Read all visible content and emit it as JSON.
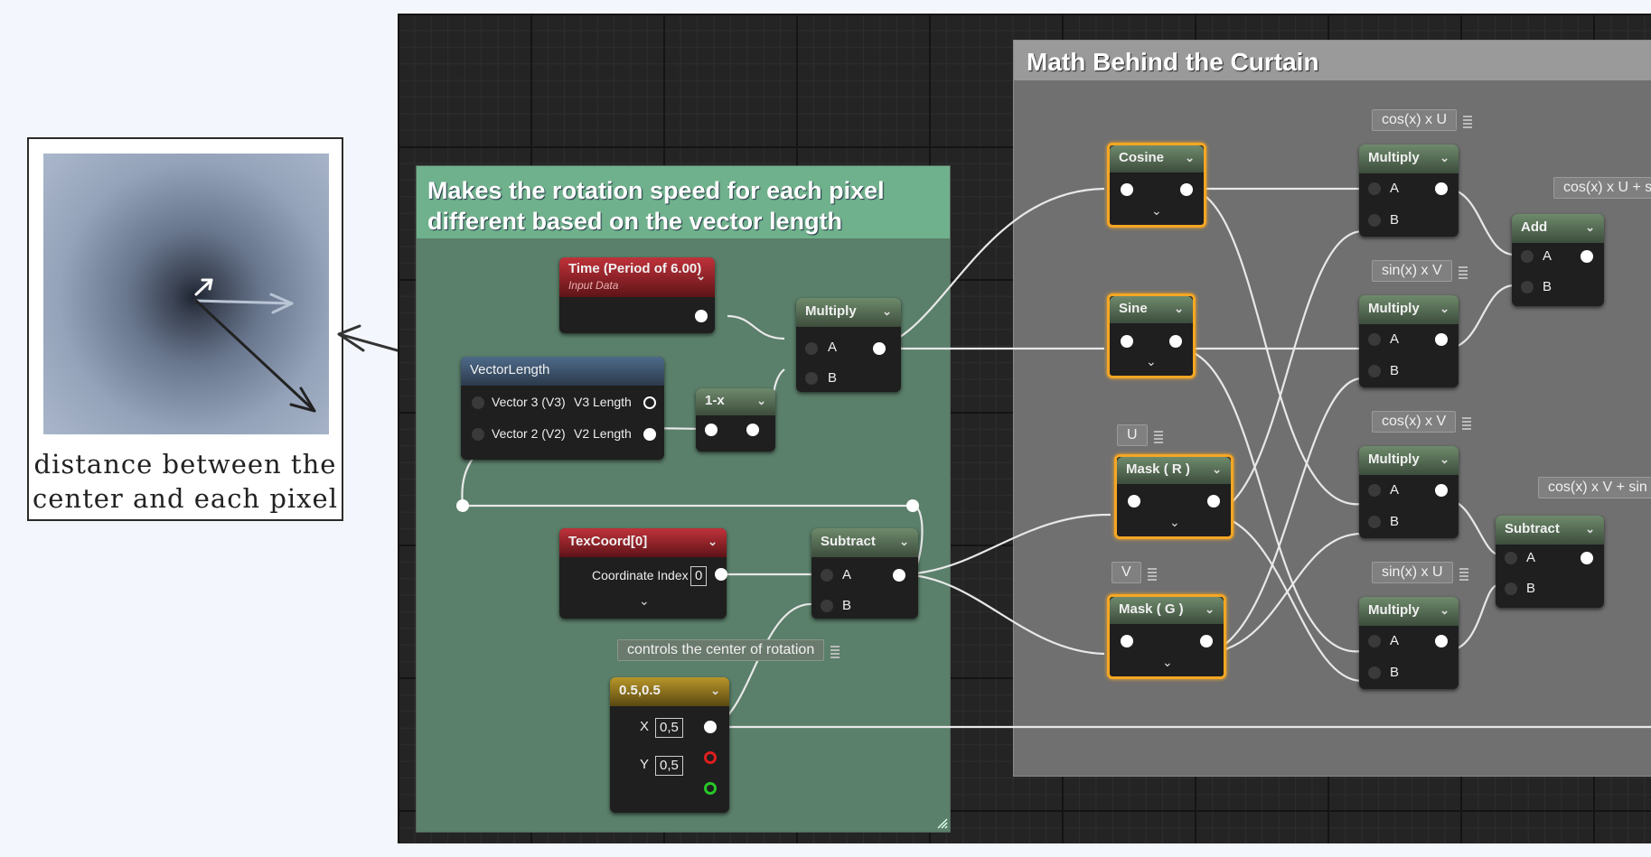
{
  "annotation": {
    "caption_line1": "distance between the",
    "caption_line2": "center and each pixel"
  },
  "comments": {
    "green_title": "Makes the rotation speed for each pixel different based on the vector length",
    "gray_title": "Math Behind the Curtain"
  },
  "nodes": {
    "time": {
      "title": "Time (Period of 6.00)",
      "subtitle": "Input Data"
    },
    "vector_length": {
      "title": "VectorLength",
      "pin1": "Vector 3 (V3)",
      "out1": "V3 Length",
      "pin2": "Vector 2 (V2)",
      "out2": "V2 Length"
    },
    "one_minus_x": {
      "title": "1-x"
    },
    "multiply_main": {
      "title": "Multiply",
      "a": "A",
      "b": "B"
    },
    "texcoord": {
      "title": "TexCoord[0]",
      "param": "Coordinate Index",
      "value": "0"
    },
    "subtract_main": {
      "title": "Subtract",
      "a": "A",
      "b": "B"
    },
    "constant": {
      "title": "0.5,0.5",
      "x_label": "X",
      "x_value": "0,5",
      "y_label": "Y",
      "y_value": "0,5"
    },
    "cosine": {
      "title": "Cosine"
    },
    "sine": {
      "title": "Sine"
    },
    "mask_r": {
      "title": "Mask ( R )"
    },
    "mask_g": {
      "title": "Mask ( G )"
    },
    "mul1": {
      "title": "Multiply",
      "a": "A",
      "b": "B"
    },
    "mul2": {
      "title": "Multiply",
      "a": "A",
      "b": "B"
    },
    "mul3": {
      "title": "Multiply",
      "a": "A",
      "b": "B"
    },
    "mul4": {
      "title": "Multiply",
      "a": "A",
      "b": "B"
    },
    "add": {
      "title": "Add",
      "a": "A",
      "b": "B"
    },
    "subtract2": {
      "title": "Subtract",
      "a": "A",
      "b": "B"
    }
  },
  "reroute_labels": {
    "center": "controls the center of rotation",
    "u": "U",
    "v": "V",
    "cos_u": "cos(x) x U",
    "sin_v": "sin(x) x V",
    "cos_v": "cos(x) x V",
    "sin_u": "sin(x) x U",
    "cos_u_plus": "cos(x) x U + s",
    "cos_v_plus": "cos(x) x V + sin"
  }
}
